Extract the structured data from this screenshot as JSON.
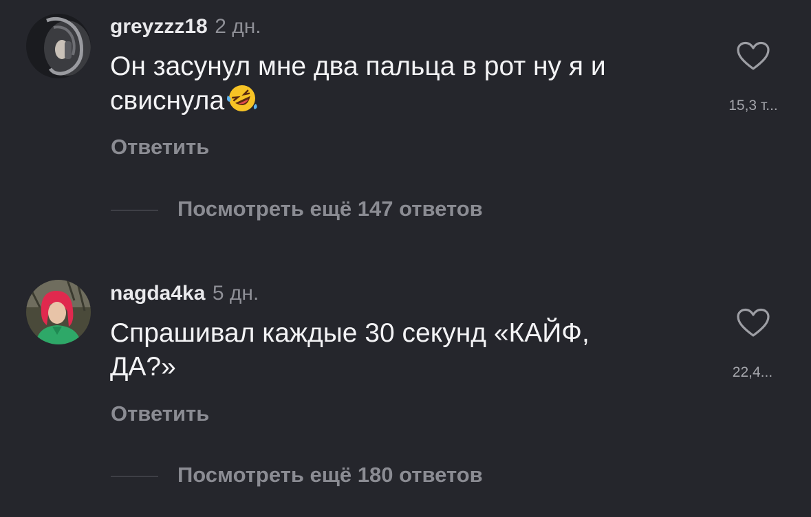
{
  "comments": [
    {
      "username": "greyzzz18",
      "time": "2 дн.",
      "text_line1": "Он засунул мне два пальца в рот ну я и",
      "text_line2": "свиснула",
      "emoji": "rolling-on-floor-laughing",
      "likes": "15,3 т...",
      "reply_label": "Ответить",
      "more_replies": "Посмотреть ещё 147 ответов"
    },
    {
      "username": "nagda4ka",
      "time": "5 дн.",
      "text_line1": "Спрашивал каждые 30 секунд «КАЙФ,",
      "text_line2": "ДА?»",
      "likes": "22,4...",
      "reply_label": "Ответить",
      "more_replies": "Посмотреть ещё 180 ответов"
    }
  ],
  "colors": {
    "background": "#25262c",
    "text": "#f3f3f5",
    "muted": "#8b8c93"
  },
  "icons": [
    "heart-icon"
  ]
}
